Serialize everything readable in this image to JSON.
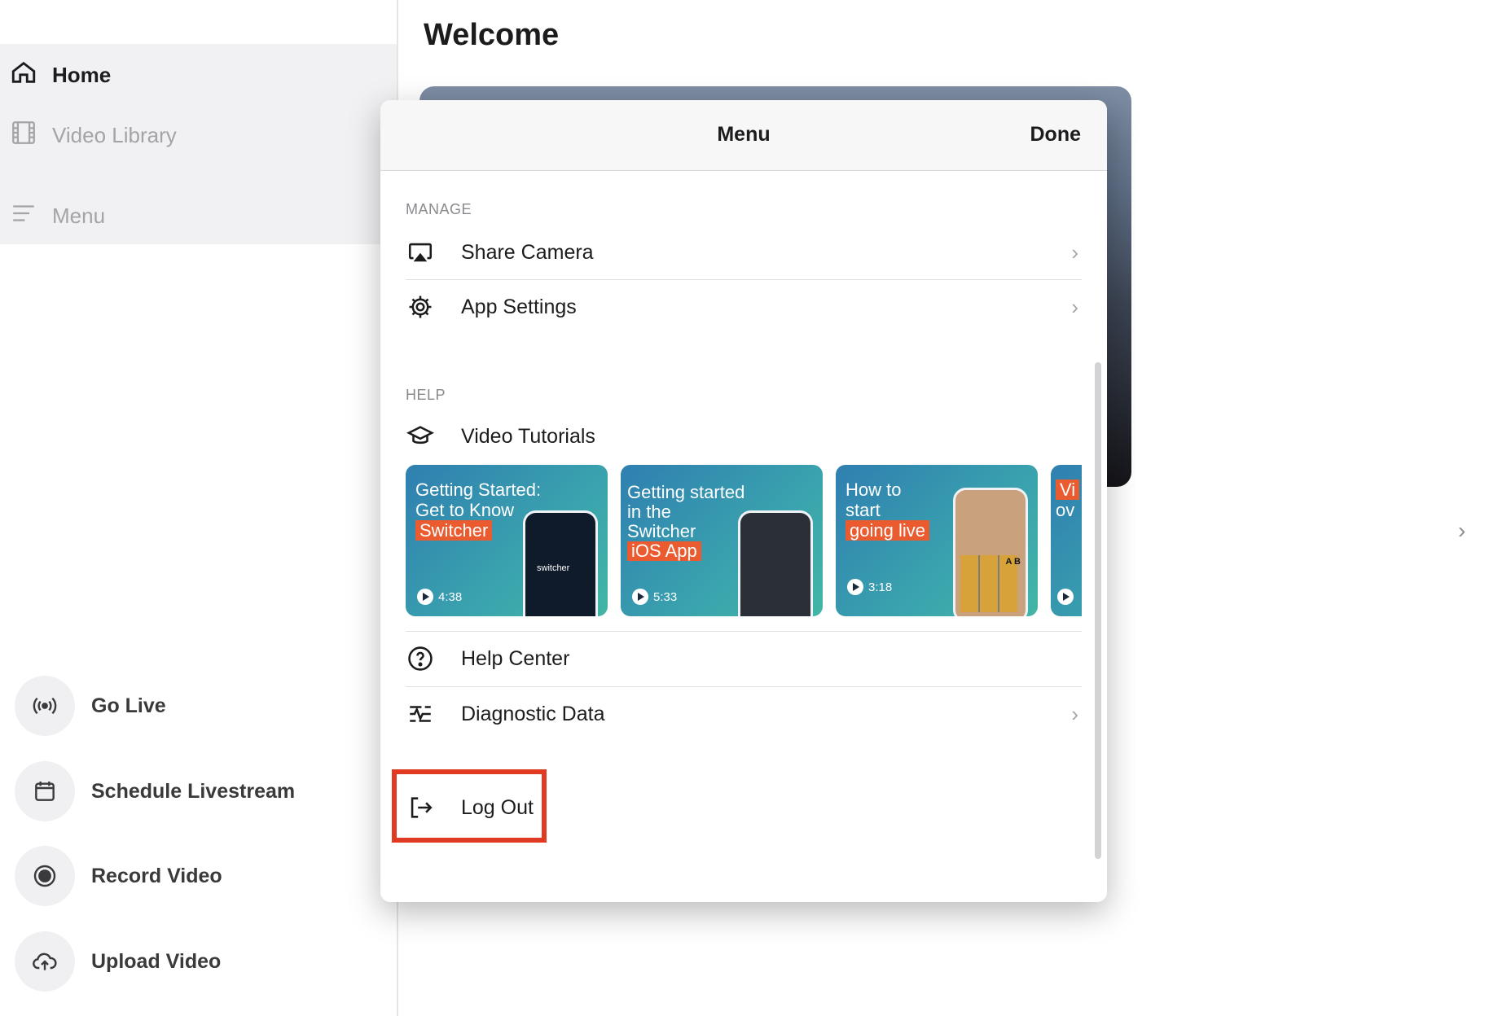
{
  "sidebar": {
    "nav": [
      {
        "label": "Home",
        "icon": "home-icon"
      },
      {
        "label": "Video Library",
        "icon": "film-icon"
      },
      {
        "label": "Menu",
        "icon": "menu-lines-icon"
      }
    ],
    "actions": [
      {
        "label": "Go Live",
        "icon": "broadcast-icon"
      },
      {
        "label": "Schedule Livestream",
        "icon": "calendar-icon"
      },
      {
        "label": "Record Video",
        "icon": "record-icon"
      },
      {
        "label": "Upload Video",
        "icon": "cloud-upload-icon"
      }
    ]
  },
  "main": {
    "title": "Welcome"
  },
  "modal": {
    "title": "Menu",
    "done_label": "Done",
    "manage_header": "MANAGE",
    "manage_items": [
      {
        "label": "Share Camera",
        "icon": "airplay-icon",
        "chevron": true
      },
      {
        "label": "App Settings",
        "icon": "gear-icon",
        "chevron": true
      }
    ],
    "help_header": "HELP",
    "tutorials_label": "Video Tutorials",
    "tutorials": [
      {
        "title_line1": "Getting Started:",
        "title_line2": "Get to Know",
        "tag": "Switcher",
        "duration": "4:38",
        "phone_brand": "switcher"
      },
      {
        "title_line1": "Getting started",
        "title_line2": "in the",
        "title_line3": "Switcher",
        "tag": "iOS App",
        "duration": "5:33"
      },
      {
        "title_line1": "How to",
        "title_line2": "start",
        "tag": "going live",
        "duration": "3:18",
        "phone_letters": "A B"
      },
      {
        "title_line1": "Vi",
        "title_line2": "ov"
      }
    ],
    "help_items": [
      {
        "label": "Help Center",
        "icon": "question-circle-icon",
        "chevron": false
      },
      {
        "label": "Diagnostic Data",
        "icon": "diagnostic-icon",
        "chevron": true
      }
    ],
    "logout_label": "Log Out",
    "highlight_color": "#e03a22"
  }
}
